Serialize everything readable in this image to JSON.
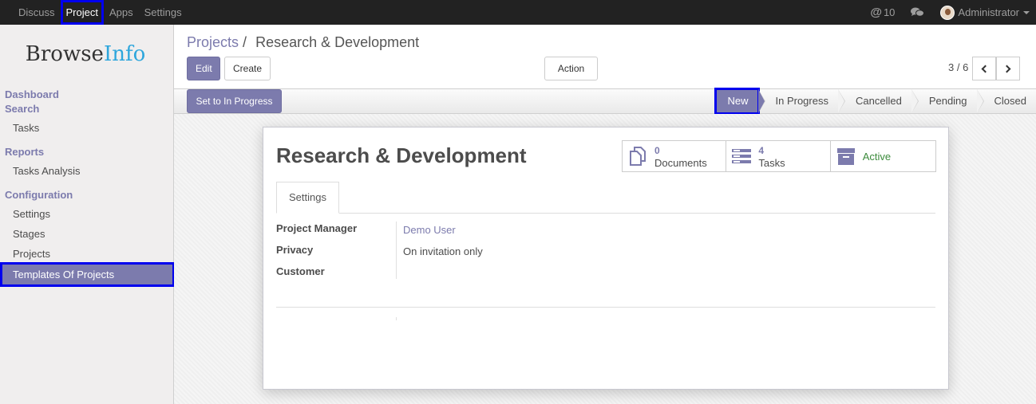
{
  "topbar": {
    "menu": [
      "Discuss",
      "Project",
      "Apps",
      "Settings"
    ],
    "active_menu": "Project",
    "mentions_count": "10",
    "user_name": "Administrator"
  },
  "sidebar": {
    "logo_part1": "Browse",
    "logo_part2": "Info",
    "sections": {
      "dashboard": "Dashboard",
      "search": "Search",
      "reports": "Reports",
      "configuration": "Configuration"
    },
    "items": {
      "tasks": "Tasks",
      "tasks_analysis": "Tasks Analysis",
      "settings": "Settings",
      "stages": "Stages",
      "projects": "Projects",
      "templates": "Templates Of Projects"
    }
  },
  "control_panel": {
    "breadcrumb_parent": "Projects",
    "breadcrumb_sep": "/",
    "breadcrumb_current": "Research & Development",
    "edit_label": "Edit",
    "create_label": "Create",
    "action_label": "Action",
    "pager": "3 / 6"
  },
  "statusbar": {
    "set_in_progress_label": "Set to In Progress",
    "stages": [
      "New",
      "In Progress",
      "Cancelled",
      "Pending",
      "Closed"
    ],
    "current_stage": "New"
  },
  "form": {
    "title": "Research & Development",
    "smart_buttons": {
      "documents_count": "0",
      "documents_label": "Documents",
      "tasks_count": "4",
      "tasks_label": "Tasks",
      "active_label": "Active"
    },
    "tab_settings": "Settings",
    "fields": {
      "project_manager_label": "Project Manager",
      "project_manager_value": "Demo User",
      "privacy_label": "Privacy",
      "privacy_value": "On invitation only",
      "customer_label": "Customer"
    }
  },
  "colors": {
    "accent": "#7c7bad",
    "highlight": "#0000ee",
    "topbar": "#222222",
    "active_green": "#3c8b3c"
  }
}
